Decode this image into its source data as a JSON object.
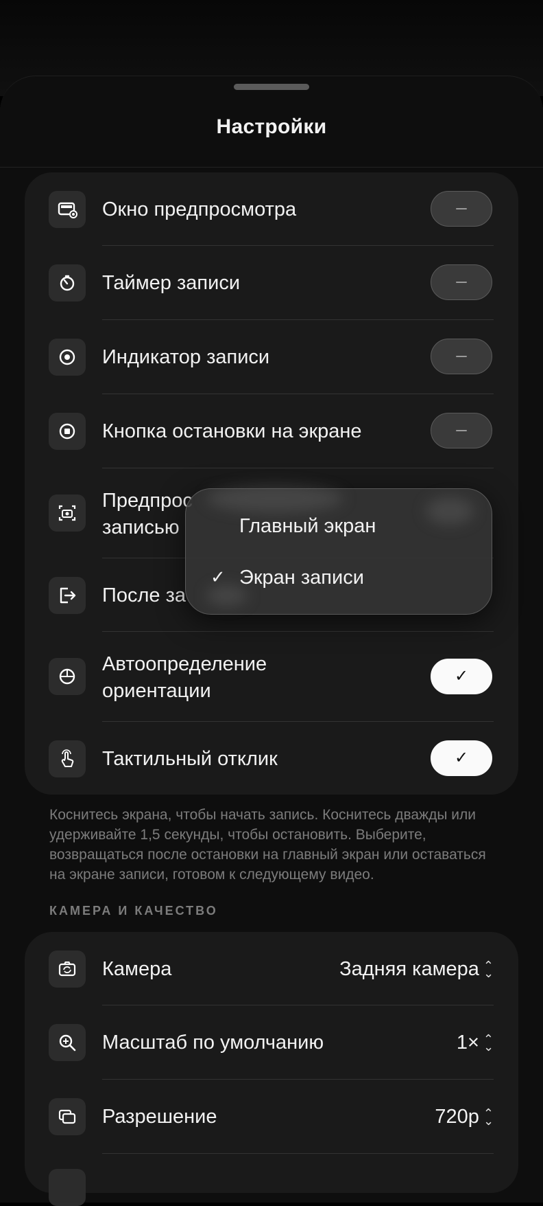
{
  "sheet": {
    "title": "Настройки"
  },
  "settings": [
    {
      "label": "Окно предпросмотра",
      "icon": "preview-window-icon",
      "toggle": "off"
    },
    {
      "label": "Таймер записи",
      "icon": "timer-icon",
      "toggle": "off"
    },
    {
      "label": "Индикатор записи",
      "icon": "record-indicator-icon",
      "toggle": "off"
    },
    {
      "label": "Кнопка остановки на экране",
      "icon": "stop-button-icon",
      "toggle": "off"
    },
    {
      "label_line1": "Предпрос",
      "label_line2": "записью",
      "icon": "camera-preview-icon"
    },
    {
      "label": "После за",
      "icon": "exit-icon"
    },
    {
      "label_line1": "Автоопределение",
      "label_line2": "ориентации",
      "icon": "orientation-icon",
      "toggle": "on"
    },
    {
      "label": "Тактильный отклик",
      "icon": "haptic-touch-icon",
      "toggle": "on"
    }
  ],
  "toggle_on_symbol": "✓",
  "footnote": "Коснитесь экрана, чтобы начать запись. Коснитесь дважды или удерживайте 1,5 секунды, чтобы остановить. Выберите, возвращаться после остановки на главный экран или оставаться на экране записи, готовом к следующему видео.",
  "camera_section": {
    "header": "КАМЕРА И КАЧЕСТВО",
    "rows": [
      {
        "label": "Камера",
        "value": "Задняя камера",
        "icon": "camera-switch-icon"
      },
      {
        "label": "Масштаб по умолчанию",
        "value": "1×",
        "icon": "zoom-icon"
      },
      {
        "label": "Разрешение",
        "value": "720p",
        "icon": "resolution-icon"
      }
    ]
  },
  "popup_menu": {
    "options": [
      "Главный экран",
      "Экран записи"
    ],
    "selected_index": 1,
    "check_symbol": "✓"
  }
}
